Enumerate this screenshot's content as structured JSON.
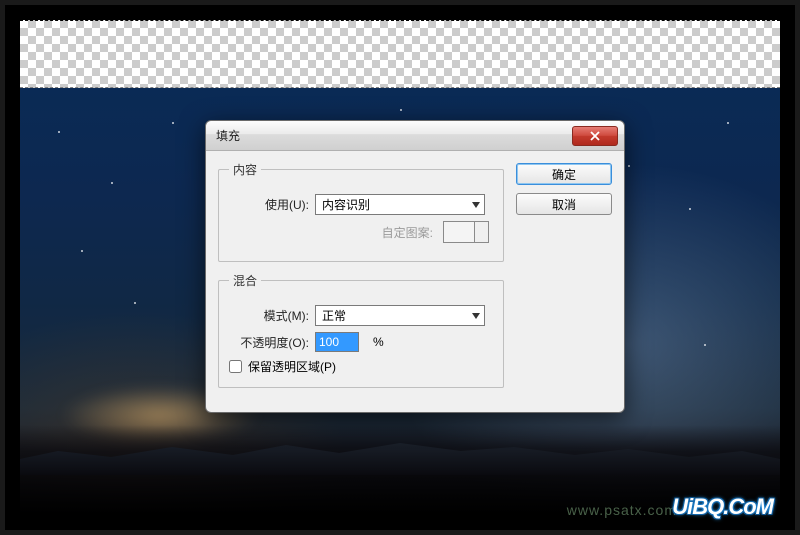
{
  "dialog": {
    "title": "填充",
    "buttons": {
      "ok": "确定",
      "cancel": "取消"
    },
    "content": {
      "legend": "内容",
      "use_label": "使用(U):",
      "use_value": "内容识别",
      "pattern_label": "自定图案:"
    },
    "blend": {
      "legend": "混合",
      "mode_label": "模式(M):",
      "mode_value": "正常",
      "opacity_label": "不透明度(O):",
      "opacity_value": "100",
      "opacity_unit": "%",
      "preserve_label": "保留透明区域(P)",
      "preserve_checked": false
    }
  },
  "watermark": {
    "main": "UiBQ.CoM",
    "faint": "www.psatx.com"
  },
  "colors": {
    "accent": "#3399ff",
    "close": "#c33a2d"
  }
}
